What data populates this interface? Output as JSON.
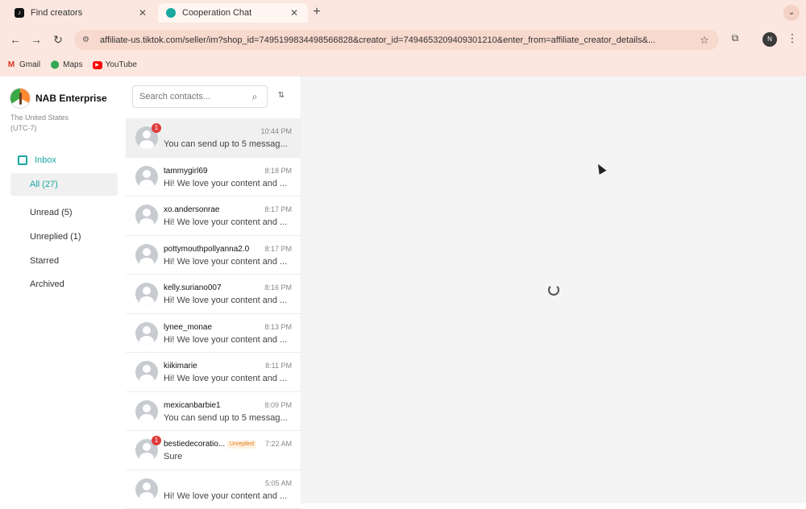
{
  "browser": {
    "tabs": [
      {
        "title": "Find creators",
        "active": false
      },
      {
        "title": "Cooperation Chat",
        "active": true
      }
    ],
    "new_tab": "+",
    "menu": "⌄",
    "url": "affiliate-us.tiktok.com/seller/im?shop_id=7495199834498566828&creator_id=7494653209409301210&enter_from=affiliate_creator_details&...",
    "profile_initial": "N",
    "bookmarks": [
      {
        "label": "Gmail",
        "icon": "gmail-icon"
      },
      {
        "label": "Maps",
        "icon": "maps-icon"
      },
      {
        "label": "YouTube",
        "icon": "youtube-icon"
      }
    ]
  },
  "shop": {
    "name": "NAB Enterprise",
    "region_line1": "The United States",
    "region_line2": "(UTC-7)"
  },
  "nav": {
    "inbox_label": "Inbox",
    "filters": [
      {
        "label": "All (27)",
        "active": true
      },
      {
        "label": "Unread (5)",
        "active": false
      },
      {
        "label": "Unreplied (1)",
        "active": false
      },
      {
        "label": "Starred",
        "active": false
      },
      {
        "label": "Archived",
        "active": false
      }
    ]
  },
  "search": {
    "placeholder": "Search contacts..."
  },
  "conversations": [
    {
      "name": "",
      "time": "10:44 PM",
      "preview": "You can send up to 5 messag...",
      "badge": "1",
      "tag": "",
      "selected": true
    },
    {
      "name": "tammygirl69",
      "time": "8:18 PM",
      "preview": "Hi! We love your content and ...",
      "badge": "",
      "tag": "",
      "selected": false
    },
    {
      "name": "xo.andersonrae",
      "time": "8:17 PM",
      "preview": "Hi! We love your content and ...",
      "badge": "",
      "tag": "",
      "selected": false
    },
    {
      "name": "pottymouthpollyanna2.0",
      "time": "8:17 PM",
      "preview": "Hi! We love your content and ...",
      "badge": "",
      "tag": "",
      "selected": false
    },
    {
      "name": "kelly.suriano007",
      "time": "8:16 PM",
      "preview": "Hi! We love your content and ...",
      "badge": "",
      "tag": "",
      "selected": false
    },
    {
      "name": "lynee_monae",
      "time": "8:13 PM",
      "preview": "Hi! We love your content and ...",
      "badge": "",
      "tag": "",
      "selected": false
    },
    {
      "name": "kiikimarie",
      "time": "8:11 PM",
      "preview": "Hi! We love your content and ...",
      "badge": "",
      "tag": "",
      "selected": false
    },
    {
      "name": "mexicanbarbie1",
      "time": "8:09 PM",
      "preview": "You can send up to 5 messag...",
      "badge": "",
      "tag": "",
      "selected": false
    },
    {
      "name": "bestiedecoratio...",
      "time": "7:22 AM",
      "preview": "Sure",
      "badge": "1",
      "tag": "Unreplied",
      "selected": false
    },
    {
      "name": "",
      "time": "5:05 AM",
      "preview": "Hi! We love your content and ...",
      "badge": "",
      "tag": "",
      "selected": false
    }
  ]
}
